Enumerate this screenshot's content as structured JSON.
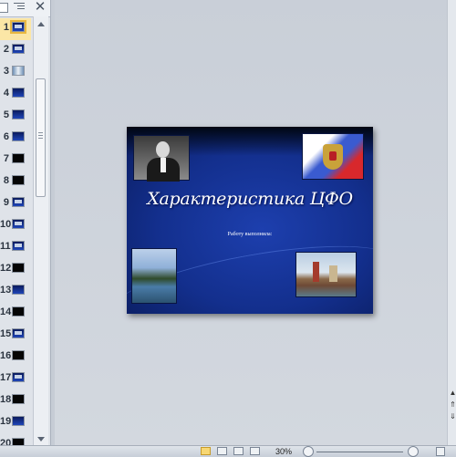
{
  "thumbnail_pane": {
    "close_glyph": "✕",
    "slides": [
      {
        "number": "1",
        "style": "pic",
        "selected": true
      },
      {
        "number": "2",
        "style": "pic"
      },
      {
        "number": "3",
        "style": "light"
      },
      {
        "number": "4",
        "style": "blue"
      },
      {
        "number": "5",
        "style": "blue"
      },
      {
        "number": "6",
        "style": "blue"
      },
      {
        "number": "7",
        "style": "black"
      },
      {
        "number": "8",
        "style": "black"
      },
      {
        "number": "9",
        "style": "pic"
      },
      {
        "number": "10",
        "style": "pic"
      },
      {
        "number": "11",
        "style": "pic"
      },
      {
        "number": "12",
        "style": "black"
      },
      {
        "number": "13",
        "style": "blue"
      },
      {
        "number": "14",
        "style": "black"
      },
      {
        "number": "15",
        "style": "pic"
      },
      {
        "number": "16",
        "style": "black"
      },
      {
        "number": "17",
        "style": "pic"
      },
      {
        "number": "18",
        "style": "black"
      },
      {
        "number": "19",
        "style": "blue"
      },
      {
        "number": "20",
        "style": "black"
      }
    ]
  },
  "slide": {
    "title": "Характеристика ЦФО",
    "subtitle": "Работу выполнила:",
    "background_color": "#132f8d"
  },
  "status_bar": {
    "zoom": "30%"
  }
}
